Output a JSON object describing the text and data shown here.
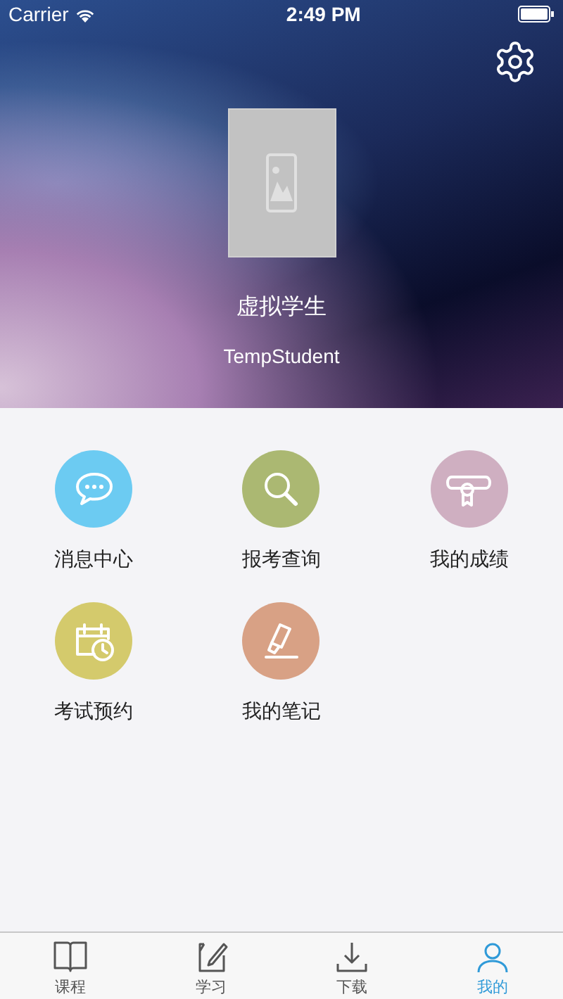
{
  "status_bar": {
    "carrier": "Carrier",
    "time": "2:49 PM"
  },
  "profile": {
    "name": "虚拟学生",
    "username": "TempStudent"
  },
  "menu": [
    {
      "kind": "message",
      "label": "消息中心",
      "color": "#6ccbf2"
    },
    {
      "kind": "search",
      "label": "报考查询",
      "color": "#abb872"
    },
    {
      "kind": "certificate",
      "label": "我的成绩",
      "color": "#cfafc1"
    },
    {
      "kind": "calendar",
      "label": "考试预约",
      "color": "#d4ca6c"
    },
    {
      "kind": "note",
      "label": "我的笔记",
      "color": "#d8a185"
    }
  ],
  "tabs": [
    {
      "kind": "book",
      "label": "课程",
      "selected": false
    },
    {
      "kind": "study",
      "label": "学习",
      "selected": false
    },
    {
      "kind": "download",
      "label": "下载",
      "selected": false
    },
    {
      "kind": "user",
      "label": "我的",
      "selected": true
    }
  ]
}
